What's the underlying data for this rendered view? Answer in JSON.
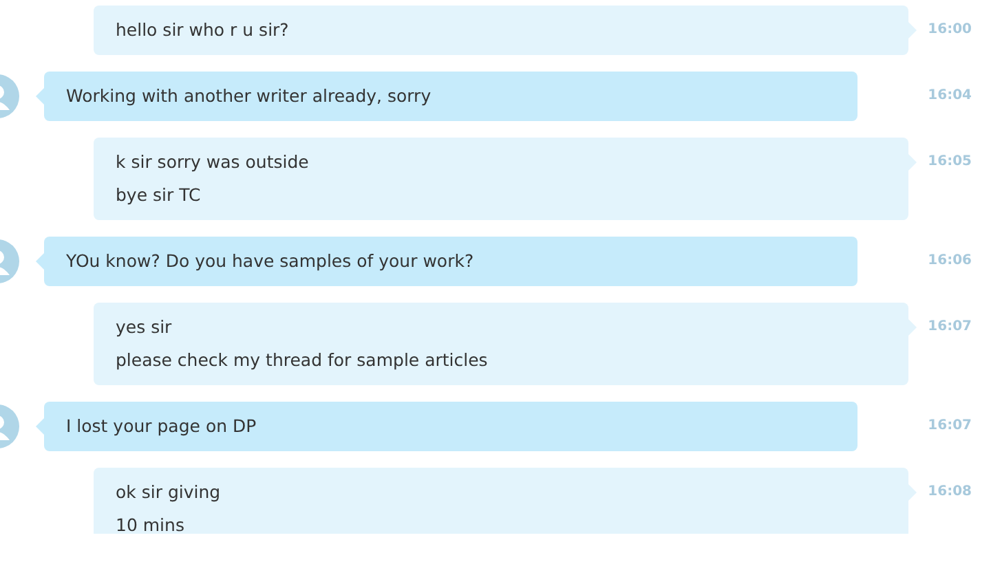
{
  "messages": [
    {
      "kind": "sent",
      "lines": [
        "hello sir who r u sir?"
      ],
      "time": "16:00"
    },
    {
      "kind": "received",
      "lines": [
        "Working with another writer already, sorry"
      ],
      "time": "16:04"
    },
    {
      "kind": "sent",
      "lines": [
        "k sir sorry was outside",
        "bye sir TC"
      ],
      "time": "16:05"
    },
    {
      "kind": "received",
      "lines": [
        "YOu know? Do you have samples of your work?"
      ],
      "time": "16:06"
    },
    {
      "kind": "sent",
      "lines": [
        "yes sir",
        "please check my thread for sample articles"
      ],
      "time": "16:07"
    },
    {
      "kind": "received",
      "lines": [
        "I lost your page on DP"
      ],
      "time": "16:07"
    },
    {
      "kind": "sent",
      "lines": [
        "ok sir giving",
        "10 mins"
      ],
      "time": "16:08"
    }
  ]
}
